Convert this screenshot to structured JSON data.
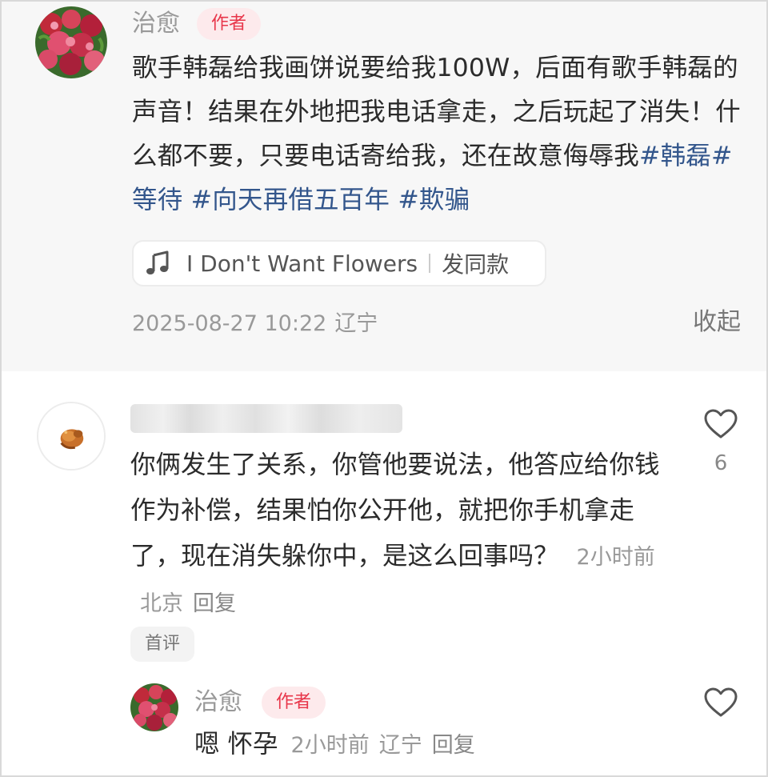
{
  "post": {
    "author_name": "治愈",
    "author_tag": "作者",
    "text_before_tags": "歌手韩磊给我画饼说要给我100W，后面有歌手韩磊的声音！结果在外地把我电话拿走，之后玩起了消失！什么都不要，只要电话寄给我，还在故意侮辱我",
    "hashtags": [
      "#韩磊",
      "#等待",
      " #向天再借五百年",
      " #欺骗"
    ],
    "music": {
      "icon": "music-note-icon",
      "song_title": "I Don't Want Flowers",
      "action_label": "发同款"
    },
    "timestamp": "2025-08-27 10:22",
    "location": "辽宁",
    "collapse_label": "收起"
  },
  "comment": {
    "username_blurred": "██████████",
    "text": "你俩发生了关系，你管他要说法，他答应给你钱作为补偿，结果怕你公开他，就把你手机拿走了，现在消失躲你中，是这么回事吗？",
    "time": "2小时前",
    "location": "北京",
    "reply_label": "回复",
    "like_icon": "heart-outline-icon",
    "like_count": "6",
    "badge": "首评"
  },
  "reply": {
    "author_name": "治愈",
    "author_tag": "作者",
    "text": "嗯 怀孕",
    "time": "2小时前",
    "location": "辽宁",
    "reply_label": "回复",
    "like_icon": "heart-outline-icon"
  },
  "colors": {
    "post_background": "#f7f7f7",
    "hashtag": "#33568c",
    "author_tag_bg": "#fdeaec",
    "author_tag_text": "#e8364a",
    "meta_text": "#999999"
  }
}
